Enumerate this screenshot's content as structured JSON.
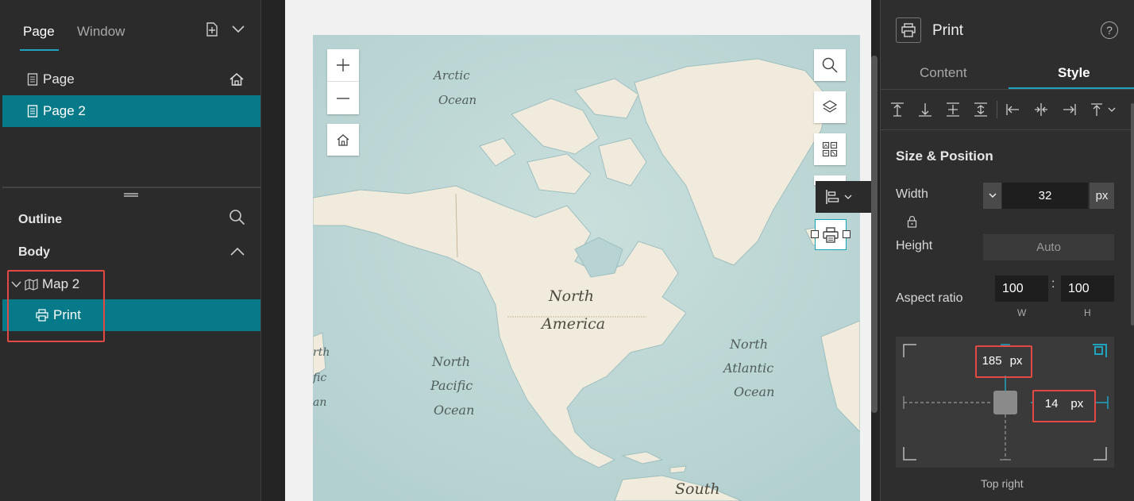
{
  "left_panel": {
    "tabs": [
      "Page",
      "Window"
    ],
    "pages": [
      {
        "label": "Page",
        "is_home": true,
        "selected": false
      },
      {
        "label": "Page 2",
        "is_home": false,
        "selected": true
      }
    ],
    "outline_title": "Outline",
    "body_title": "Body",
    "tree": {
      "map_label": "Map 2",
      "print_label": "Print"
    }
  },
  "map": {
    "labels": {
      "arctic_ocean_1": "Arctic",
      "arctic_ocean_2": "Ocean",
      "north_america_1": "North",
      "north_america_2": "America",
      "north_pacific_1": "North",
      "north_pacific_2": "Pacific",
      "north_pacific_3": "Ocean",
      "north_atlantic_1": "North",
      "north_atlantic_2": "Atlantic",
      "north_atlantic_3": "Ocean",
      "south": "South",
      "edge_1": "rth",
      "edge_2": "fic",
      "edge_3": "an"
    },
    "colors": {
      "ocean": "#bcd6d6",
      "land": "#f0ebdd"
    }
  },
  "right_panel": {
    "title": "Print",
    "tabs": [
      "Content",
      "Style"
    ],
    "active_tab": "Style",
    "section_title": "Size & Position",
    "width_label": "Width",
    "width_value": "32",
    "width_unit": "px",
    "height_label": "Height",
    "height_value": "Auto",
    "aspect_label": "Aspect ratio",
    "aspect_w": "100",
    "aspect_h": "100",
    "aspect_sep": ":",
    "aspect_w_label": "W",
    "aspect_h_label": "H",
    "offset_top_value": "185",
    "offset_top_unit": "px",
    "offset_right_value": "14",
    "offset_right_unit": "px",
    "anchor_label": "Top right"
  },
  "accent_color": "#077a8a",
  "highlight_color": "#e04a43"
}
